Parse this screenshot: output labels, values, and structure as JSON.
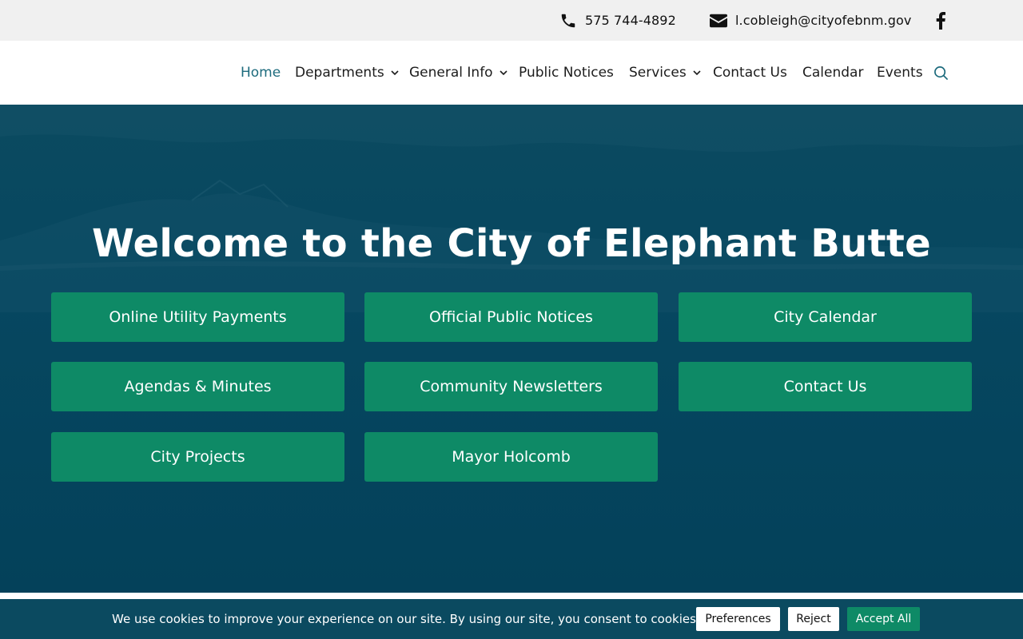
{
  "topbar": {
    "phone": "575 744-4892",
    "email": "l.cobleigh@cityofebnm.gov",
    "icons": {
      "phone": "phone-icon",
      "email": "envelope-icon",
      "social": "facebook-icon"
    }
  },
  "nav": {
    "items": [
      {
        "label": "Home",
        "active": true
      },
      {
        "label": "Departments",
        "dropdown": true
      },
      {
        "label": "General Info",
        "dropdown": true
      },
      {
        "label": "Public Notices"
      },
      {
        "label": "Services",
        "dropdown": true
      },
      {
        "label": "Contact Us"
      },
      {
        "label": "Calendar"
      },
      {
        "label": "Events"
      }
    ],
    "search_icon": "search-icon"
  },
  "hero": {
    "title": "Welcome to the City of Elephant Butte",
    "buttons": [
      "Online Utility Payments",
      "Official Public Notices",
      "City Calendar",
      "Agendas & Minutes",
      "Community Newsletters",
      "Contact Us",
      "City Projects",
      "Mayor Holcomb"
    ]
  },
  "cookie": {
    "message": "We use cookies to improve your experience on our site. By using our site, you consent to cookies.",
    "preferences": "Preferences",
    "reject": "Reject",
    "accept": "Accept All"
  },
  "colors": {
    "hero_bg": "#064760",
    "button_green": "#0e8a66",
    "active_nav": "#1d6b7d",
    "topbar_bg": "#f0f0f0"
  }
}
